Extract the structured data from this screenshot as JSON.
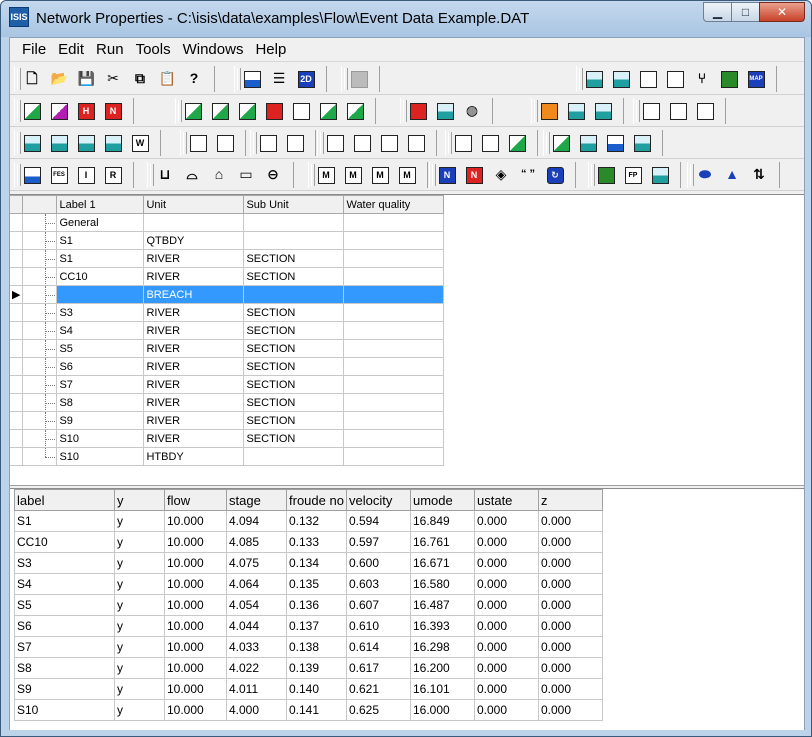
{
  "window": {
    "app_icon_text": "ISIS",
    "title": "Network Properties - C:\\isis\\data\\examples\\Flow\\Event Data Example.DAT",
    "minimize_glyph": "▁",
    "maximize_glyph": "□",
    "close_glyph": "✕"
  },
  "menu": [
    "File",
    "Edit",
    "Run",
    "Tools",
    "Windows",
    "Help"
  ],
  "toolbar_text": {
    "new": "🗋",
    "open": "📂",
    "save": "💾",
    "cut": "✂",
    "copy": "⧉",
    "paste": "📋",
    "help": "?",
    "fes": "FES",
    "info": "I",
    "report": "R",
    "fp": "FP",
    "map": "MAP",
    "mark_n": "N",
    "quote": "“ ”",
    "twod": "2D"
  },
  "network_table": {
    "headers": [
      "Label 1",
      "Unit",
      "Sub Unit",
      "Water quality"
    ],
    "row_marker": "▶",
    "rows": [
      {
        "icon": "G",
        "icon_type": "general",
        "label": "General",
        "unit": "",
        "sub": "",
        "wq": ""
      },
      {
        "icon": "",
        "icon_type": "qt",
        "label": "S1",
        "unit": "QTBDY",
        "sub": "",
        "wq": ""
      },
      {
        "icon": "",
        "icon_type": "river",
        "label": "S1",
        "unit": "RIVER",
        "sub": "SECTION",
        "wq": ""
      },
      {
        "icon": "",
        "icon_type": "river",
        "label": "CC10",
        "unit": "RIVER",
        "sub": "SECTION",
        "wq": ""
      },
      {
        "icon": "",
        "icon_type": "breach",
        "label": "",
        "unit": "BREACH",
        "sub": "",
        "wq": "",
        "selected": true
      },
      {
        "icon": "",
        "icon_type": "river",
        "label": "S3",
        "unit": "RIVER",
        "sub": "SECTION",
        "wq": ""
      },
      {
        "icon": "",
        "icon_type": "river",
        "label": "S4",
        "unit": "RIVER",
        "sub": "SECTION",
        "wq": ""
      },
      {
        "icon": "",
        "icon_type": "river",
        "label": "S5",
        "unit": "RIVER",
        "sub": "SECTION",
        "wq": ""
      },
      {
        "icon": "",
        "icon_type": "river",
        "label": "S6",
        "unit": "RIVER",
        "sub": "SECTION",
        "wq": ""
      },
      {
        "icon": "",
        "icon_type": "river",
        "label": "S7",
        "unit": "RIVER",
        "sub": "SECTION",
        "wq": ""
      },
      {
        "icon": "",
        "icon_type": "river",
        "label": "S8",
        "unit": "RIVER",
        "sub": "SECTION",
        "wq": ""
      },
      {
        "icon": "",
        "icon_type": "river",
        "label": "S9",
        "unit": "RIVER",
        "sub": "SECTION",
        "wq": ""
      },
      {
        "icon": "",
        "icon_type": "river",
        "label": "S10",
        "unit": "RIVER",
        "sub": "SECTION",
        "wq": ""
      },
      {
        "icon": "H",
        "icon_type": "ht",
        "label": "S10",
        "unit": "HTBDY",
        "sub": "",
        "wq": ""
      }
    ]
  },
  "results_table": {
    "headers": [
      "label",
      "y",
      "flow",
      "stage",
      "froude no",
      "velocity",
      "umode",
      "ustate",
      "z"
    ],
    "rows": [
      [
        "S1",
        "y",
        "10.000",
        "4.094",
        "0.132",
        "0.594",
        "16.849",
        "0.000",
        "0.000"
      ],
      [
        "CC10",
        "y",
        "10.000",
        "4.085",
        "0.133",
        "0.597",
        "16.761",
        "0.000",
        "0.000"
      ],
      [
        "S3",
        "y",
        "10.000",
        "4.075",
        "0.134",
        "0.600",
        "16.671",
        "0.000",
        "0.000"
      ],
      [
        "S4",
        "y",
        "10.000",
        "4.064",
        "0.135",
        "0.603",
        "16.580",
        "0.000",
        "0.000"
      ],
      [
        "S5",
        "y",
        "10.000",
        "4.054",
        "0.136",
        "0.607",
        "16.487",
        "0.000",
        "0.000"
      ],
      [
        "S6",
        "y",
        "10.000",
        "4.044",
        "0.137",
        "0.610",
        "16.393",
        "0.000",
        "0.000"
      ],
      [
        "S7",
        "y",
        "10.000",
        "4.033",
        "0.138",
        "0.614",
        "16.298",
        "0.000",
        "0.000"
      ],
      [
        "S8",
        "y",
        "10.000",
        "4.022",
        "0.139",
        "0.617",
        "16.200",
        "0.000",
        "0.000"
      ],
      [
        "S9",
        "y",
        "10.000",
        "4.011",
        "0.140",
        "0.621",
        "16.101",
        "0.000",
        "0.000"
      ],
      [
        "S10",
        "y",
        "10.000",
        "4.000",
        "0.141",
        "0.625",
        "16.000",
        "0.000",
        "0.000"
      ]
    ]
  }
}
